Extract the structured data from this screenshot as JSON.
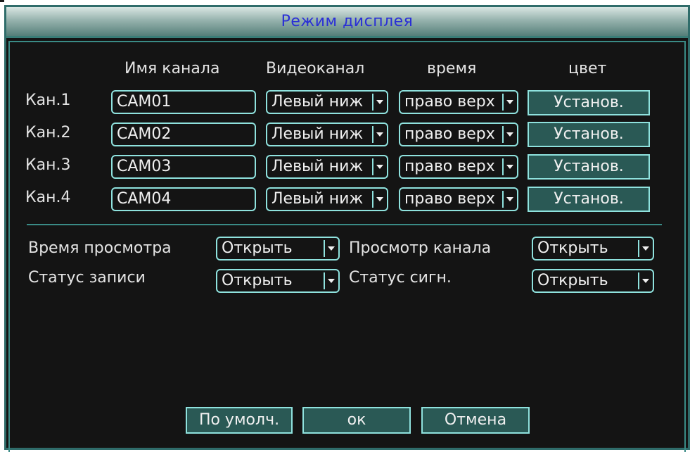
{
  "dialog": {
    "title": "Режим дисплея"
  },
  "columns": {
    "channel_name": "Имя канала",
    "video_channel": "Видеоканал",
    "time": "время",
    "color": "цвет"
  },
  "channels": [
    {
      "label": "Кан.1",
      "name": "CAM01",
      "video_pos": "Левый ниж",
      "time_pos": "право верх",
      "set_label": "Установ."
    },
    {
      "label": "Кан.2",
      "name": "CAM02",
      "video_pos": "Левый ниж",
      "time_pos": "право верх",
      "set_label": "Установ."
    },
    {
      "label": "Кан.3",
      "name": "CAM03",
      "video_pos": "Левый ниж",
      "time_pos": "право верх",
      "set_label": "Установ."
    },
    {
      "label": "Кан.4",
      "name": "CAM04",
      "video_pos": "Левый ниж",
      "time_pos": "право верх",
      "set_label": "Установ."
    }
  ],
  "options": {
    "preview_time": {
      "label": "Время просмотра",
      "value": "Открыть"
    },
    "record_status": {
      "label": "Статус записи",
      "value": "Открыть"
    },
    "channel_preview": {
      "label": "Просмотр канала",
      "value": "Открыть"
    },
    "alarm_status": {
      "label": "Статус сигн.",
      "value": "Открыть"
    }
  },
  "buttons": {
    "default": "По умолч.",
    "ok": "ок",
    "cancel": "Отмена"
  },
  "colors": {
    "title_text": "#2a2fd6",
    "border_accent": "#8fe2de",
    "button_fill": "#2a5955",
    "background": "#141414"
  }
}
